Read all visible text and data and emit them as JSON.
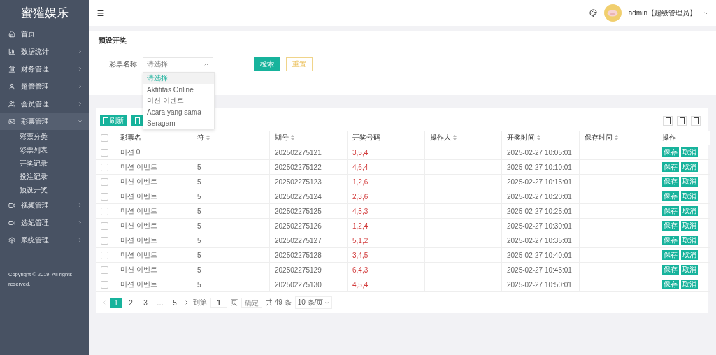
{
  "sidebar": {
    "logo": "蜜獾娱乐",
    "items": [
      {
        "label": "首页",
        "kind": "link",
        "expanded": false
      },
      {
        "label": "数据统计",
        "kind": "menu",
        "expanded": false
      },
      {
        "label": "财务管理",
        "kind": "menu",
        "expanded": false
      },
      {
        "label": "超管管理",
        "kind": "menu",
        "expanded": false
      },
      {
        "label": "会员管理",
        "kind": "menu",
        "expanded": false
      },
      {
        "label": "彩票管理",
        "kind": "menu",
        "expanded": true,
        "children": [
          {
            "label": "彩票分类"
          },
          {
            "label": "彩票列表"
          },
          {
            "label": "开奖记录"
          },
          {
            "label": "投注记录"
          },
          {
            "label": "预设开奖"
          }
        ]
      },
      {
        "label": "视频管理",
        "kind": "menu",
        "expanded": false
      },
      {
        "label": "选妃管理",
        "kind": "menu",
        "expanded": false
      },
      {
        "label": "系统管理",
        "kind": "menu",
        "expanded": false
      }
    ],
    "copyright": "Copyright © 2019. All rights reserved."
  },
  "topbar": {
    "user": "admin【超级管理员】"
  },
  "page_title": "预设开奖",
  "filter": {
    "label": "彩票名称",
    "select": {
      "placeholder": "请选择",
      "expanded": true,
      "options": [
        {
          "label": "请选择",
          "selected": true
        },
        {
          "label": "Aktifitas Online",
          "selected": false
        },
        {
          "label": "미션 이벤트",
          "selected": false
        },
        {
          "label": "Acara yang sama",
          "selected": false
        },
        {
          "label": "Seragam",
          "selected": false
        }
      ]
    },
    "buttons": [
      {
        "label": "检索",
        "kind": "primary"
      },
      {
        "label": "重置",
        "kind": "outline"
      }
    ]
  },
  "toolbar": [
    {
      "kind": "labeled",
      "label": "刷新"
    },
    {
      "kind": "icon"
    }
  ],
  "table": {
    "select_all": {
      "checked": false
    },
    "columns": [
      {
        "label": "彩票名",
        "sortable": false
      },
      {
        "label": "符",
        "sortable": true
      },
      {
        "label": "期号",
        "sortable": true
      },
      {
        "label": "开奖号码",
        "sortable": false
      },
      {
        "label": "操作人",
        "sortable": true
      },
      {
        "label": "开奖时间",
        "sortable": true
      },
      {
        "label": "保存时间",
        "sortable": true
      },
      {
        "label": "操作",
        "sortable": false
      }
    ],
    "rows": [
      {
        "checked": false,
        "name": "미션 0",
        "issue": "202502275121",
        "numbers": "3,5,4",
        "time": "2025-02-27 10:05:01",
        "actions": [
          "保存",
          "取消"
        ]
      },
      {
        "checked": false,
        "name": "미션 이벤트",
        "count": "5",
        "issue": "202502275122",
        "numbers": "4,6,4",
        "time": "2025-02-27 10:10:01",
        "actions": [
          "保存",
          "取消"
        ]
      },
      {
        "checked": false,
        "name": "미션 이벤트",
        "count": "5",
        "issue": "202502275123",
        "numbers": "1,2,6",
        "time": "2025-02-27 10:15:01",
        "actions": [
          "保存",
          "取消"
        ]
      },
      {
        "checked": false,
        "name": "미션 이벤트",
        "count": "5",
        "issue": "202502275124",
        "numbers": "2,3,6",
        "time": "2025-02-27 10:20:01",
        "actions": [
          "保存",
          "取消"
        ]
      },
      {
        "checked": false,
        "name": "미션 이벤트",
        "count": "5",
        "issue": "202502275125",
        "numbers": "4,5,3",
        "time": "2025-02-27 10:25:01",
        "actions": [
          "保存",
          "取消"
        ]
      },
      {
        "checked": false,
        "name": "미션 이벤트",
        "count": "5",
        "issue": "202502275126",
        "numbers": "1,2,4",
        "time": "2025-02-27 10:30:01",
        "actions": [
          "保存",
          "取消"
        ]
      },
      {
        "checked": false,
        "name": "미션 이벤트",
        "count": "5",
        "issue": "202502275127",
        "numbers": "5,1,2",
        "time": "2025-02-27 10:35:01",
        "actions": [
          "保存",
          "取消"
        ]
      },
      {
        "checked": false,
        "name": "미션 이벤트",
        "count": "5",
        "issue": "202502275128",
        "numbers": "3,4,5",
        "time": "2025-02-27 10:40:01",
        "actions": [
          "保存",
          "取消"
        ]
      },
      {
        "checked": false,
        "name": "미션 이벤트",
        "count": "5",
        "issue": "202502275129",
        "numbers": "6,4,3",
        "time": "2025-02-27 10:45:01",
        "actions": [
          "保存",
          "取消"
        ]
      },
      {
        "checked": false,
        "name": "미션 이벤트",
        "count": "5",
        "issue": "202502275130",
        "numbers": "4,5,4",
        "time": "2025-02-27 10:50:01",
        "actions": [
          "保存",
          "取消"
        ]
      }
    ]
  },
  "pagination": {
    "pages": [
      {
        "label": "1",
        "selected": true
      },
      {
        "label": "2",
        "selected": false
      },
      {
        "label": "3",
        "selected": false
      },
      {
        "label": "…",
        "selected": false
      },
      {
        "label": "5",
        "selected": false
      }
    ],
    "goto_label": "到第",
    "page_value": "1",
    "page_unit": "页",
    "confirm": "确定",
    "total": "共 49 条",
    "page_size": "10 条/页"
  }
}
